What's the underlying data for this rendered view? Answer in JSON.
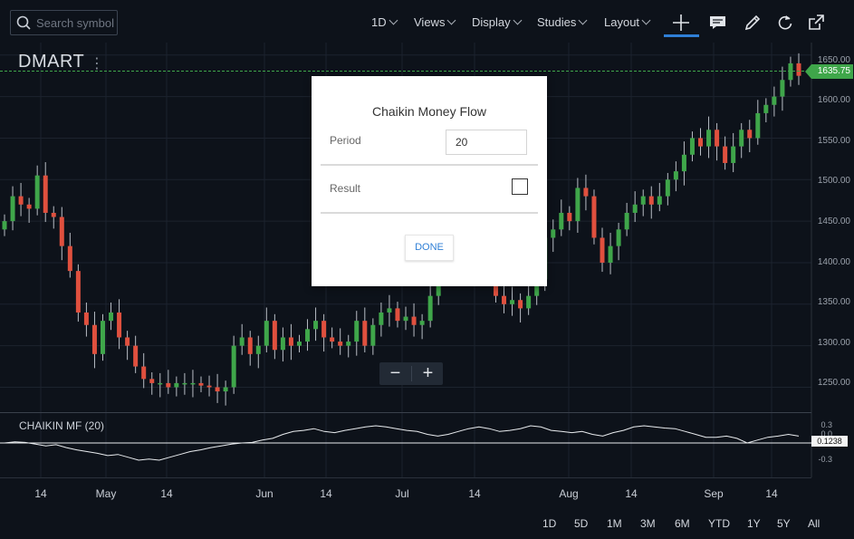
{
  "search": {
    "placeholder": "Search symbol"
  },
  "menus": {
    "interval": "1D",
    "views": "Views",
    "display": "Display",
    "studies": "Studies",
    "layout": "Layout"
  },
  "symbol": "DMART",
  "last_price": "1635.75",
  "price_ticks": [
    "1650.00",
    "1600.00",
    "1550.00",
    "1500.00",
    "1450.00",
    "1400.00",
    "1350.00",
    "1300.00",
    "1250.00"
  ],
  "indicator": {
    "label": "CHAIKIN MF (20)",
    "ticks": [
      "0.3",
      "0.0",
      "-0.3"
    ],
    "value": "0.1238"
  },
  "time_ticks": [
    "14",
    "May",
    "14",
    "Jun",
    "14",
    "Jul",
    "14",
    "Aug",
    "14",
    "Sep",
    "14"
  ],
  "ranges": [
    "1D",
    "5D",
    "1M",
    "3M",
    "6M",
    "YTD",
    "1Y",
    "5Y",
    "All"
  ],
  "zoom": {
    "minus": "−",
    "plus": "+"
  },
  "dialog": {
    "title": "Chaikin Money Flow",
    "period_label": "Period",
    "period_value": "20",
    "result_label": "Result",
    "done": "DONE"
  },
  "colors": {
    "up": "#3fa64a",
    "down": "#e0503e",
    "background": "#0d121a",
    "accent": "#2f7fd6"
  },
  "chart_data": {
    "type": "candlestick",
    "symbol": "DMART",
    "ylim": [
      1220,
      1665
    ],
    "close_series": [
      1450,
      1480,
      1470,
      1465,
      1505,
      1460,
      1455,
      1420,
      1390,
      1340,
      1325,
      1290,
      1330,
      1340,
      1310,
      1300,
      1275,
      1260,
      1255,
      1255,
      1250,
      1255,
      1255,
      1255,
      1252,
      1250,
      1245,
      1250,
      1300,
      1310,
      1290,
      1300,
      1330,
      1295,
      1310,
      1300,
      1305,
      1320,
      1330,
      1310,
      1305,
      1300,
      1305,
      1330,
      1300,
      1325,
      1340,
      1345,
      1330,
      1335,
      1325,
      1330,
      1360,
      1400,
      1450,
      1480,
      1470,
      1460,
      1440,
      1400,
      1360,
      1350,
      1355,
      1345,
      1360,
      1380,
      1430,
      1440,
      1460,
      1450,
      1490,
      1480,
      1430,
      1400,
      1420,
      1440,
      1460,
      1470,
      1480,
      1470,
      1480,
      1500,
      1510,
      1530,
      1550,
      1540,
      1560,
      1540,
      1520,
      1540,
      1560,
      1550,
      1580,
      1590,
      1600,
      1620,
      1640,
      1625
    ],
    "indicator_series": [
      0.0,
      0.02,
      0.01,
      -0.02,
      -0.05,
      -0.03,
      -0.08,
      -0.12,
      -0.15,
      -0.18,
      -0.22,
      -0.2,
      -0.25,
      -0.3,
      -0.28,
      -0.3,
      -0.25,
      -0.2,
      -0.15,
      -0.12,
      -0.08,
      -0.05,
      -0.02,
      0.0,
      0.01,
      0.05,
      0.08,
      0.15,
      0.2,
      0.22,
      0.25,
      0.2,
      0.18,
      0.22,
      0.25,
      0.28,
      0.3,
      0.28,
      0.25,
      0.22,
      0.2,
      0.15,
      0.12,
      0.15,
      0.2,
      0.25,
      0.28,
      0.25,
      0.2,
      0.22,
      0.25,
      0.3,
      0.28,
      0.22,
      0.2,
      0.18,
      0.2,
      0.15,
      0.12,
      0.18,
      0.22,
      0.28,
      0.3,
      0.28,
      0.26,
      0.25,
      0.2,
      0.15,
      0.1,
      0.1,
      0.12,
      0.08,
      0.0,
      0.05,
      0.1,
      0.12,
      0.15,
      0.12
    ]
  }
}
